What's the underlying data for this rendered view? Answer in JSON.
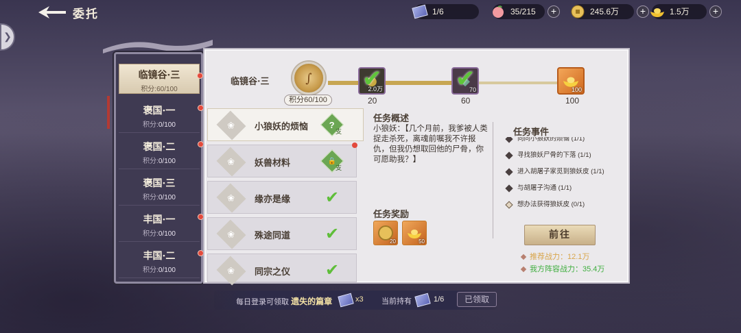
{
  "header": {
    "title": "委托"
  },
  "resources": [
    {
      "icon": "ticket-icon",
      "value": "1/6"
    },
    {
      "icon": "peach-icon",
      "value": "35/215"
    },
    {
      "icon": "copper-coin-icon",
      "value": "245.6万"
    },
    {
      "icon": "gold-ingot-icon",
      "value": "1.5万"
    }
  ],
  "chapters": [
    {
      "name": "临镜谷·三",
      "score_label": "积分:",
      "score": "60/100",
      "active": true
    },
    {
      "name": "褒国·一",
      "score_label": "积分:",
      "score": "0/100"
    },
    {
      "name": "褒国·二",
      "score_label": "积分:",
      "score": "0/100"
    },
    {
      "name": "褒国·三",
      "score_label": "积分:",
      "score": "0/100"
    },
    {
      "name": "丰国·一",
      "score_label": "积分:",
      "score": "0/100"
    },
    {
      "name": "丰国·二",
      "score_label": "积分:",
      "score": "0/100"
    }
  ],
  "progress": {
    "label": "临镜谷·三",
    "score_chip": "积分60/100",
    "fill_fraction": 0.6,
    "nodes": [
      {
        "threshold": "20",
        "amount": "2.0万",
        "claimed": true
      },
      {
        "threshold": "60",
        "amount": "70",
        "claimed": true
      },
      {
        "threshold": "100",
        "amount": "100",
        "claimed": false
      }
    ]
  },
  "tasks": [
    {
      "name": "小狼妖的烦恼",
      "status": "active",
      "badge": "?",
      "badge_sub": "支"
    },
    {
      "name": "妖兽材料",
      "status": "locked",
      "badge": "🔒",
      "badge_sub": "支"
    },
    {
      "name": "缘亦是缘",
      "status": "done"
    },
    {
      "name": "殊途同道",
      "status": "done"
    },
    {
      "name": "同宗之仪",
      "status": "done"
    }
  ],
  "overview": {
    "title": "任务概述",
    "text": "小狼妖：【几个月前，我爹被人类捉走杀死，离魂前嘱我不许报仇，但我仍想取回他的尸骨，你可愿助我？】"
  },
  "events": {
    "title": "任务事件",
    "items": [
      {
        "text": "向同小狼妖的烦恼 (1/1)",
        "done": true
      },
      {
        "text": "寻找狼妖尸骨的下落 (1/1)",
        "done": true
      },
      {
        "text": "进入胡屠子家觅到狼妖皮 (1/1)",
        "done": true
      },
      {
        "text": "与胡屠子沟通 (1/1)",
        "done": true
      },
      {
        "text": "想办法获得狼妖皮 (0/1)",
        "done": false
      }
    ]
  },
  "rewards": {
    "title": "任务奖励",
    "items": [
      {
        "icon": "copper-coin-icon",
        "amount": "20"
      },
      {
        "icon": "gold-ingot-icon",
        "amount": "50"
      }
    ]
  },
  "goto_label": "前往",
  "power": {
    "recommended": "推荐战力：12.1万",
    "mine": "我方阵容战力：35.4万",
    "recommended_color": "#d8a54a",
    "mine_color": "#3fae3f"
  },
  "bottom": {
    "daily_text": "每日登录可领取",
    "item_name": "遗失的篇章",
    "multiplier": "x3",
    "holding_label": "当前持有",
    "holding_value": "1/6",
    "claimed_label": "已领取"
  }
}
